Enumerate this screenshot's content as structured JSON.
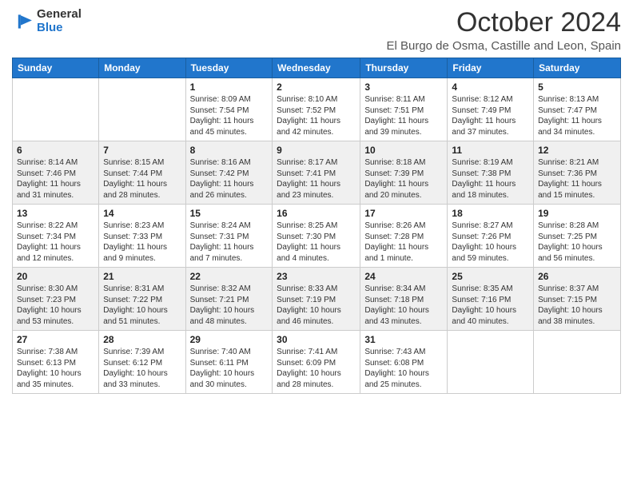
{
  "logo": {
    "general": "General",
    "blue": "Blue"
  },
  "title": "October 2024",
  "location": "El Burgo de Osma, Castille and Leon, Spain",
  "days_of_week": [
    "Sunday",
    "Monday",
    "Tuesday",
    "Wednesday",
    "Thursday",
    "Friday",
    "Saturday"
  ],
  "weeks": [
    [
      {
        "day": "",
        "info": ""
      },
      {
        "day": "",
        "info": ""
      },
      {
        "day": "1",
        "info": "Sunrise: 8:09 AM\nSunset: 7:54 PM\nDaylight: 11 hours and 45 minutes."
      },
      {
        "day": "2",
        "info": "Sunrise: 8:10 AM\nSunset: 7:52 PM\nDaylight: 11 hours and 42 minutes."
      },
      {
        "day": "3",
        "info": "Sunrise: 8:11 AM\nSunset: 7:51 PM\nDaylight: 11 hours and 39 minutes."
      },
      {
        "day": "4",
        "info": "Sunrise: 8:12 AM\nSunset: 7:49 PM\nDaylight: 11 hours and 37 minutes."
      },
      {
        "day": "5",
        "info": "Sunrise: 8:13 AM\nSunset: 7:47 PM\nDaylight: 11 hours and 34 minutes."
      }
    ],
    [
      {
        "day": "6",
        "info": "Sunrise: 8:14 AM\nSunset: 7:46 PM\nDaylight: 11 hours and 31 minutes."
      },
      {
        "day": "7",
        "info": "Sunrise: 8:15 AM\nSunset: 7:44 PM\nDaylight: 11 hours and 28 minutes."
      },
      {
        "day": "8",
        "info": "Sunrise: 8:16 AM\nSunset: 7:42 PM\nDaylight: 11 hours and 26 minutes."
      },
      {
        "day": "9",
        "info": "Sunrise: 8:17 AM\nSunset: 7:41 PM\nDaylight: 11 hours and 23 minutes."
      },
      {
        "day": "10",
        "info": "Sunrise: 8:18 AM\nSunset: 7:39 PM\nDaylight: 11 hours and 20 minutes."
      },
      {
        "day": "11",
        "info": "Sunrise: 8:19 AM\nSunset: 7:38 PM\nDaylight: 11 hours and 18 minutes."
      },
      {
        "day": "12",
        "info": "Sunrise: 8:21 AM\nSunset: 7:36 PM\nDaylight: 11 hours and 15 minutes."
      }
    ],
    [
      {
        "day": "13",
        "info": "Sunrise: 8:22 AM\nSunset: 7:34 PM\nDaylight: 11 hours and 12 minutes."
      },
      {
        "day": "14",
        "info": "Sunrise: 8:23 AM\nSunset: 7:33 PM\nDaylight: 11 hours and 9 minutes."
      },
      {
        "day": "15",
        "info": "Sunrise: 8:24 AM\nSunset: 7:31 PM\nDaylight: 11 hours and 7 minutes."
      },
      {
        "day": "16",
        "info": "Sunrise: 8:25 AM\nSunset: 7:30 PM\nDaylight: 11 hours and 4 minutes."
      },
      {
        "day": "17",
        "info": "Sunrise: 8:26 AM\nSunset: 7:28 PM\nDaylight: 11 hours and 1 minute."
      },
      {
        "day": "18",
        "info": "Sunrise: 8:27 AM\nSunset: 7:26 PM\nDaylight: 10 hours and 59 minutes."
      },
      {
        "day": "19",
        "info": "Sunrise: 8:28 AM\nSunset: 7:25 PM\nDaylight: 10 hours and 56 minutes."
      }
    ],
    [
      {
        "day": "20",
        "info": "Sunrise: 8:30 AM\nSunset: 7:23 PM\nDaylight: 10 hours and 53 minutes."
      },
      {
        "day": "21",
        "info": "Sunrise: 8:31 AM\nSunset: 7:22 PM\nDaylight: 10 hours and 51 minutes."
      },
      {
        "day": "22",
        "info": "Sunrise: 8:32 AM\nSunset: 7:21 PM\nDaylight: 10 hours and 48 minutes."
      },
      {
        "day": "23",
        "info": "Sunrise: 8:33 AM\nSunset: 7:19 PM\nDaylight: 10 hours and 46 minutes."
      },
      {
        "day": "24",
        "info": "Sunrise: 8:34 AM\nSunset: 7:18 PM\nDaylight: 10 hours and 43 minutes."
      },
      {
        "day": "25",
        "info": "Sunrise: 8:35 AM\nSunset: 7:16 PM\nDaylight: 10 hours and 40 minutes."
      },
      {
        "day": "26",
        "info": "Sunrise: 8:37 AM\nSunset: 7:15 PM\nDaylight: 10 hours and 38 minutes."
      }
    ],
    [
      {
        "day": "27",
        "info": "Sunrise: 7:38 AM\nSunset: 6:13 PM\nDaylight: 10 hours and 35 minutes."
      },
      {
        "day": "28",
        "info": "Sunrise: 7:39 AM\nSunset: 6:12 PM\nDaylight: 10 hours and 33 minutes."
      },
      {
        "day": "29",
        "info": "Sunrise: 7:40 AM\nSunset: 6:11 PM\nDaylight: 10 hours and 30 minutes."
      },
      {
        "day": "30",
        "info": "Sunrise: 7:41 AM\nSunset: 6:09 PM\nDaylight: 10 hours and 28 minutes."
      },
      {
        "day": "31",
        "info": "Sunrise: 7:43 AM\nSunset: 6:08 PM\nDaylight: 10 hours and 25 minutes."
      },
      {
        "day": "",
        "info": ""
      },
      {
        "day": "",
        "info": ""
      }
    ]
  ]
}
